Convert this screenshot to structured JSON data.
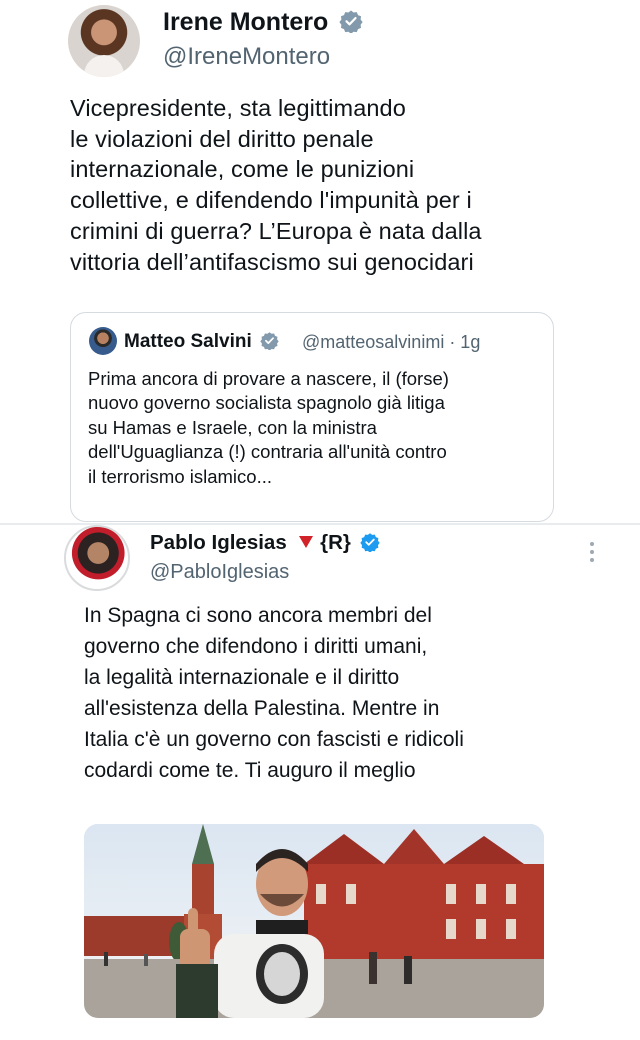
{
  "tweet1": {
    "name": "Irene Montero",
    "handle": "@IreneMontero",
    "text": "Vicepresidente, sta legittimando\nle violazioni del diritto penale\ninternazionale, come le punizioni\ncollettive, e difendendo l'impunità per i\ncrimini di guerra? L’Europa è nata dalla\nvittoria dell’antifascismo sui genocidari",
    "verified_color": "#829aab"
  },
  "quoted": {
    "name": "Matteo Salvini",
    "handle_time": "@matteosalvinimi · 1g",
    "text": "Prima ancora di provare a nascere, il (forse)\nnuovo governo socialista spagnolo già litiga\nsu Hamas e Israele, con la ministra\ndell'Uguaglianza (!) contraria all'unità contro\nil terrorismo islamico...",
    "verified_color": "#829aab"
  },
  "tweet2": {
    "name": "Pablo Iglesias",
    "name_suffix": "{R}",
    "handle": "@PabloIglesias",
    "text": "In Spagna ci sono ancora membri del\ngoverno che difendono i diritti umani,\nla legalità internazionale e il diritto\nall'esistenza della Palestina. Mentre in\nItalia c'è un governo con fascisti e ridicoli\ncodardi come te. Ti auguro il meglio",
    "verified_color": "#1d9bf0",
    "triangle_color": "#d2232a"
  },
  "icons": {
    "more": "more-vertical-icon",
    "verified": "verified-badge-icon",
    "triangle": "red-triangle-emoji"
  }
}
